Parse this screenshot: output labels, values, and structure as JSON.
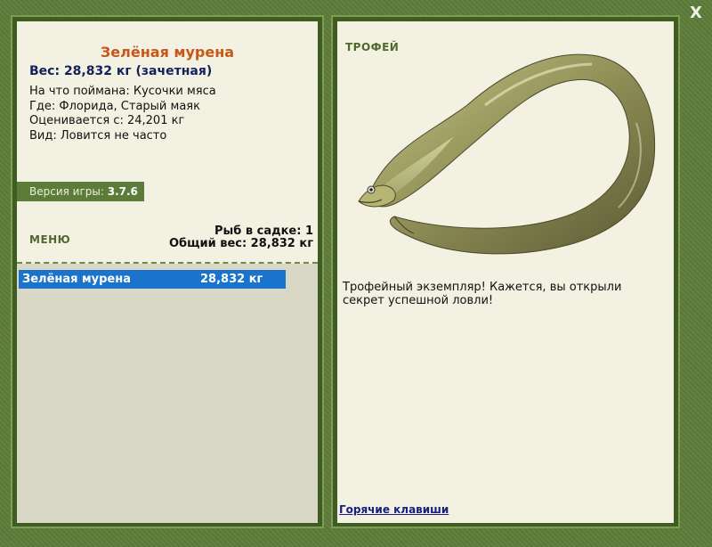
{
  "close_label": "X",
  "fish": {
    "title": "Зелёная мурена",
    "weight": "Вес: 28,832 кг (зачетная)",
    "info": [
      "На что поймана: Кусочки мяса",
      "Где: Флорида, Старый маяк",
      "Оценивается с: 24,201 кг",
      "Вид: Ловится не часто"
    ]
  },
  "version": {
    "label": "Версия игры:",
    "value": "3.7.6"
  },
  "menu_label": "МЕНЮ",
  "stats": {
    "fish_count": "Рыб в садке: 1",
    "total_weight": "Общий вес: 28,832 кг"
  },
  "catch_list": [
    {
      "name": "Зелёная мурена",
      "weight": "28,832 кг"
    }
  ],
  "trophy": {
    "label": "ТРОФЕЙ",
    "text": "Трофейный экземпляр! Кажется, вы открыли секрет успешной ловли!",
    "image_icon": "moray-eel-image"
  },
  "hotkeys_label": "Горячие клавиши",
  "colors": {
    "frame": "#5d7c39",
    "panel_bg": "#f3f1e2",
    "title_orange": "#c8571a",
    "weight_navy": "#14205a",
    "selection_blue": "#1a74cc"
  }
}
